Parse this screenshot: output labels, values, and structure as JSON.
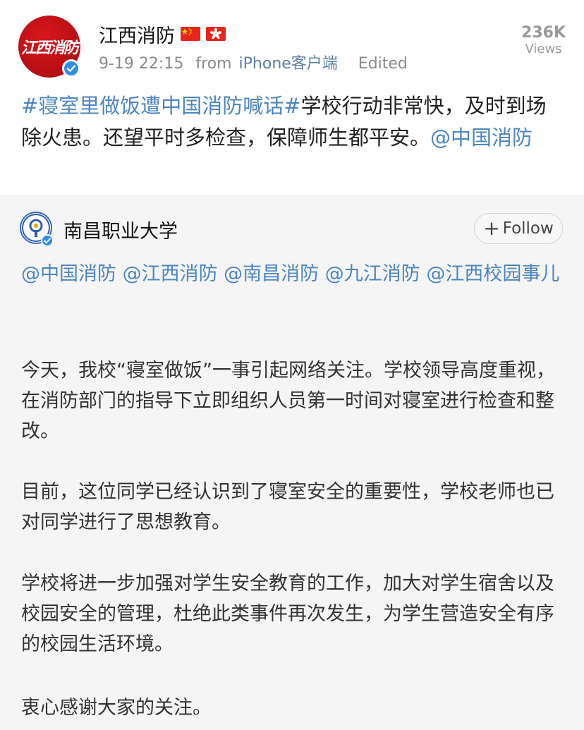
{
  "post": {
    "author": "江西消防",
    "avatar_text": "江西消防",
    "flags": [
      "china-flag",
      "hong-kong-flag"
    ],
    "timestamp": "9-19 22:15",
    "source_prefix": "from",
    "source_app": "iPhone客户端",
    "edited_label": "Edited",
    "views_count": "236K",
    "views_label": "Views",
    "text": {
      "hashtag": "#寝室里做饭遭中国消防喊话#",
      "body": "学校行动非常快，及时到场除火患。还望平时多检查，保障师生都平安。",
      "mention": "@中国消防"
    }
  },
  "repost": {
    "author": "南昌职业大学",
    "follow_label": "Follow",
    "mentions": "@中国消防 @江西消防 @南昌消防 @九江消防 @江西校园事儿",
    "paragraphs": [
      "今天，我校“寝室做饭”一事引起网络关注。学校领导高度重视，在消防部门的指导下立即组织人员第一时间对寝室进行检查和整改。",
      "目前，这位同学已经认识到了寝室安全的重要性，学校老师也已对同学进行了思想教育。",
      "学校将进一步加强对学生安全教育的工作，加大对学生宿舍以及校园安全的管理，杜绝此类事件再次发生，为学生营造安全有序的校园生活环境。",
      "衷心感谢大家的关注。"
    ]
  },
  "colors": {
    "link": "#4d86c0",
    "verified": "#2f8fe0",
    "avatar_red": "#c8141a",
    "repost_bg": "#f5f5f5"
  }
}
